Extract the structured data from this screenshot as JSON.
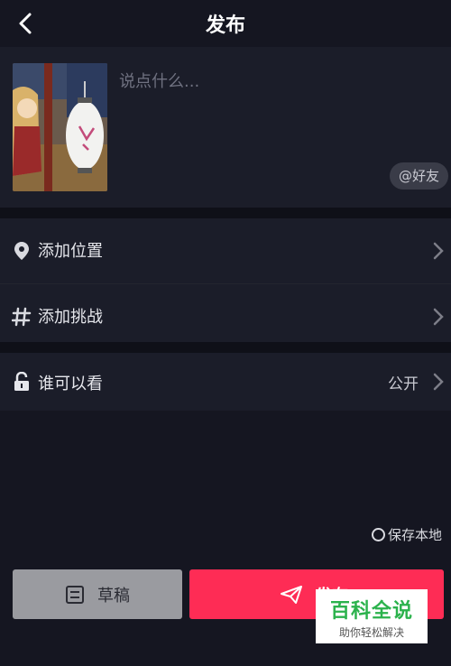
{
  "header": {
    "title": "发布"
  },
  "compose": {
    "caption_placeholder": "说点什么...",
    "mention_label": "@好友"
  },
  "options": {
    "location_label": "添加位置",
    "challenge_label": "添加挑战",
    "visibility_label": "谁可以看",
    "visibility_value": "公开"
  },
  "save_local_label": "保存本地",
  "actions": {
    "draft_label": "草稿",
    "publish_label": "发布"
  },
  "watermark": {
    "title": "百科全说",
    "subtitle": "助你轻松解决"
  },
  "colors": {
    "accent": "#fe2c55",
    "background": "#151621",
    "panel": "#1b1d29"
  }
}
